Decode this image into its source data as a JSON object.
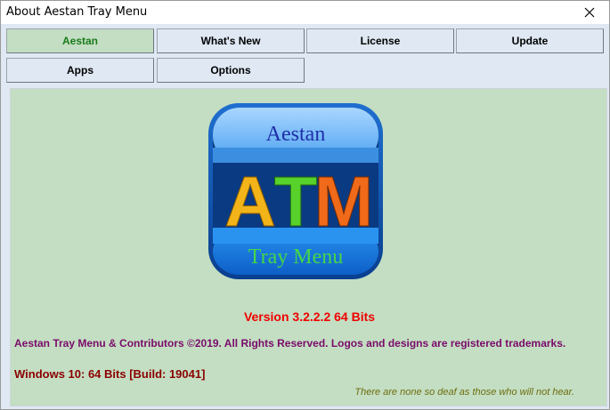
{
  "window": {
    "title": "About Aestan Tray Menu"
  },
  "tabs": [
    {
      "label": "Aestan",
      "active": true
    },
    {
      "label": "What's New",
      "active": false
    },
    {
      "label": "License",
      "active": false
    },
    {
      "label": "Update",
      "active": false
    },
    {
      "label": "Apps",
      "active": false
    },
    {
      "label": "Options",
      "active": false
    }
  ],
  "logo": {
    "top_text": "Aestan",
    "main_text_a": "A",
    "main_text_t": "T",
    "main_text_m": "M",
    "bottom_text": "Tray Menu"
  },
  "info": {
    "version": "Version 3.2.2.2 64 Bits",
    "copyright": "Aestan Tray Menu & Contributors ©2019. All Rights Reserved. Logos and designs are registered trademarks.",
    "os": "Windows 10: 64 Bits [Build: 19041]",
    "quote": "There are none so deaf as those who will not hear."
  },
  "colors": {
    "panel_bg": "#c3dec2",
    "version": "#f00000",
    "copyright": "#7a0b6a",
    "os": "#8b0000",
    "quote": "#6d6d10"
  }
}
